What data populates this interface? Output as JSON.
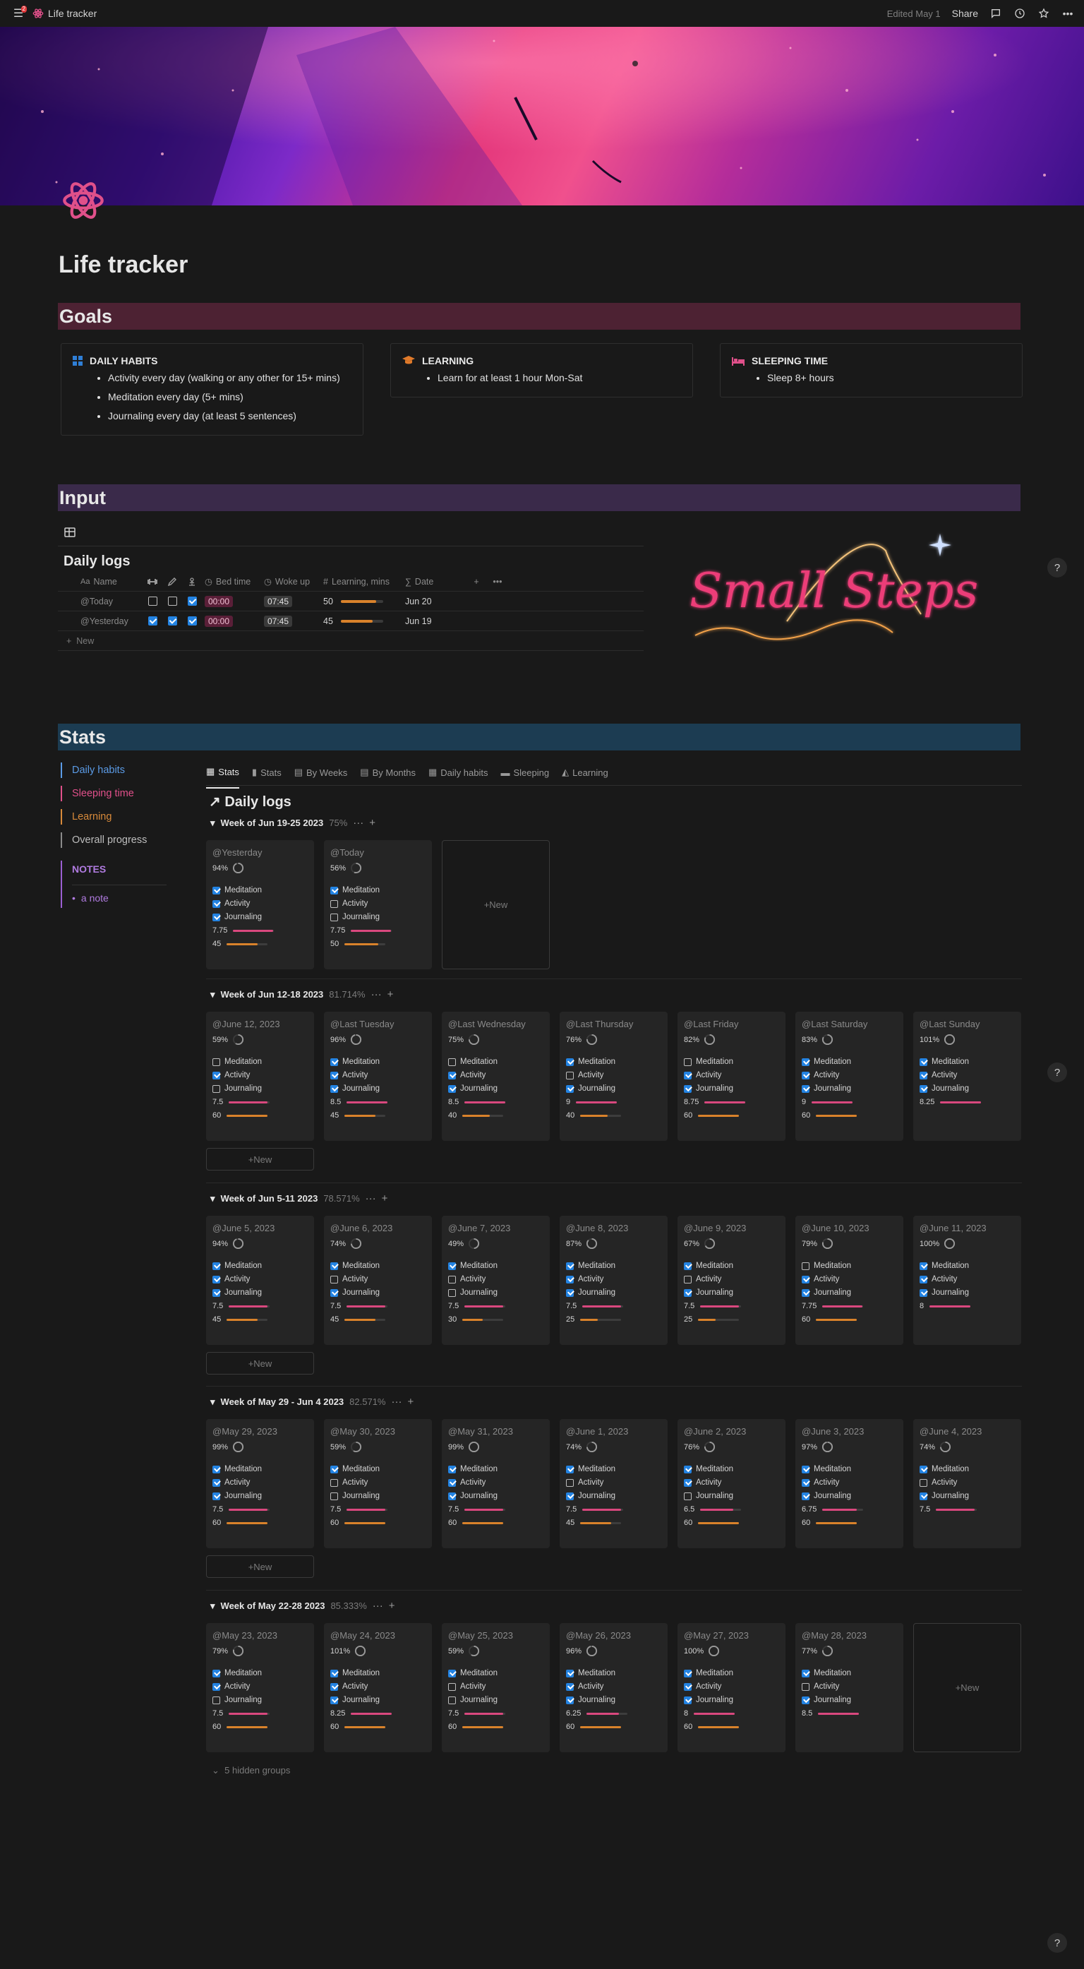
{
  "topbar": {
    "notif_count": "2",
    "page_name": "Life tracker",
    "edited": "Edited May 1",
    "share": "Share"
  },
  "page": {
    "title": "Life tracker"
  },
  "goals": {
    "header": "Goals",
    "cards": [
      {
        "title": "DAILY HABITS",
        "items": [
          "Activity every day (walking or any other for 15+ mins)",
          "Meditation every day (5+ mins)",
          "Journaling every day (at least 5 sentences)"
        ]
      },
      {
        "title": "LEARNING",
        "items": [
          "Learn for at least 1 hour Mon-Sat"
        ]
      },
      {
        "title": "SLEEPING TIME",
        "items": [
          "Sleep 8+ hours"
        ]
      }
    ]
  },
  "input": {
    "header": "Input",
    "db_title": "Daily logs",
    "columns": {
      "name": "Name",
      "bed": "Bed time",
      "woke": "Woke up",
      "learn": "Learning, mins",
      "date": "Date"
    },
    "rows": [
      {
        "name": "@Today",
        "c1": false,
        "c2": false,
        "c3": true,
        "bed": "00:00",
        "woke": "07:45",
        "learn": "50",
        "learn_frac": 0.83,
        "date": "Jun 20"
      },
      {
        "name": "@Yesterday",
        "c1": true,
        "c2": true,
        "c3": true,
        "bed": "00:00",
        "woke": "07:45",
        "learn": "45",
        "learn_frac": 0.75,
        "date": "Jun 19"
      }
    ],
    "new_label": "New"
  },
  "logo": {
    "text": "Small Steps"
  },
  "stats": {
    "header": "Stats",
    "sidebar": [
      {
        "label": "Daily habits",
        "color": "#5b9be6"
      },
      {
        "label": "Sleeping time",
        "color": "#e0508a"
      },
      {
        "label": "Learning",
        "color": "#d88a3a"
      },
      {
        "label": "Overall progress",
        "color": "#bdbdbd"
      }
    ],
    "notes_title": "NOTES",
    "note": "a note",
    "tabs": [
      "Stats",
      "Stats",
      "By Weeks",
      "By Months",
      "Daily habits",
      "Sleeping",
      "Learning"
    ],
    "board_title": "Daily logs",
    "new_label": "New",
    "hidden_groups": "5 hidden groups"
  },
  "labels": {
    "meditation": "Meditation",
    "activity": "Activity",
    "journaling": "Journaling"
  },
  "colors": {
    "pink": "#d9487e",
    "orange": "#d9822b",
    "blue": "#2383e2"
  },
  "groups": [
    {
      "title": "Week of Jun 19-25 2023",
      "pct": "75%",
      "cards": [
        {
          "date": "@Yesterday",
          "pct": "94%",
          "m": true,
          "a": true,
          "j": true,
          "sleep": "7.75",
          "sleep_frac": 0.97,
          "learn": "45",
          "learn_frac": 0.75
        },
        {
          "date": "@Today",
          "pct": "56%",
          "m": true,
          "a": false,
          "j": false,
          "sleep": "7.75",
          "sleep_frac": 0.97,
          "learn": "50",
          "learn_frac": 0.83
        }
      ]
    },
    {
      "title": "Week of Jun 12-18 2023",
      "pct": "81.714%",
      "cards": [
        {
          "date": "@June 12, 2023",
          "pct": "59%",
          "m": false,
          "a": true,
          "j": false,
          "sleep": "7.5",
          "sleep_frac": 0.94,
          "learn": "60",
          "learn_frac": 1.0
        },
        {
          "date": "@Last Tuesday",
          "pct": "96%",
          "m": true,
          "a": true,
          "j": true,
          "sleep": "8.5",
          "sleep_frac": 1.0,
          "learn": "45",
          "learn_frac": 0.75
        },
        {
          "date": "@Last Wednesday",
          "pct": "75%",
          "m": false,
          "a": true,
          "j": true,
          "sleep": "8.5",
          "sleep_frac": 1.0,
          "learn": "40",
          "learn_frac": 0.67
        },
        {
          "date": "@Last Thursday",
          "pct": "76%",
          "m": true,
          "a": false,
          "j": true,
          "sleep": "9",
          "sleep_frac": 1.0,
          "learn": "40",
          "learn_frac": 0.67
        },
        {
          "date": "@Last Friday",
          "pct": "82%",
          "m": false,
          "a": true,
          "j": true,
          "sleep": "8.75",
          "sleep_frac": 1.0,
          "learn": "60",
          "learn_frac": 1.0
        },
        {
          "date": "@Last Saturday",
          "pct": "83%",
          "m": true,
          "a": true,
          "j": true,
          "sleep": "9",
          "sleep_frac": 1.0,
          "learn": "60",
          "learn_frac": 1.0
        },
        {
          "date": "@Last Sunday",
          "pct": "101%",
          "m": true,
          "a": true,
          "j": true,
          "sleep": "8.25",
          "sleep_frac": 1.0,
          "learn": "",
          "learn_frac": 0
        }
      ]
    },
    {
      "title": "Week of Jun 5-11 2023",
      "pct": "78.571%",
      "cards": [
        {
          "date": "@June 5, 2023",
          "pct": "94%",
          "m": true,
          "a": true,
          "j": true,
          "sleep": "7.5",
          "sleep_frac": 0.94,
          "learn": "45",
          "learn_frac": 0.75
        },
        {
          "date": "@June 6, 2023",
          "pct": "74%",
          "m": true,
          "a": false,
          "j": true,
          "sleep": "7.5",
          "sleep_frac": 0.94,
          "learn": "45",
          "learn_frac": 0.75
        },
        {
          "date": "@June 7, 2023",
          "pct": "49%",
          "m": true,
          "a": false,
          "j": false,
          "sleep": "7.5",
          "sleep_frac": 0.94,
          "learn": "30",
          "learn_frac": 0.5
        },
        {
          "date": "@June 8, 2023",
          "pct": "87%",
          "m": true,
          "a": true,
          "j": true,
          "sleep": "7.5",
          "sleep_frac": 0.94,
          "learn": "25",
          "learn_frac": 0.42
        },
        {
          "date": "@June 9, 2023",
          "pct": "67%",
          "m": true,
          "a": false,
          "j": true,
          "sleep": "7.5",
          "sleep_frac": 0.94,
          "learn": "25",
          "learn_frac": 0.42
        },
        {
          "date": "@June 10, 2023",
          "pct": "79%",
          "m": false,
          "a": true,
          "j": true,
          "sleep": "7.75",
          "sleep_frac": 0.97,
          "learn": "60",
          "learn_frac": 1.0
        },
        {
          "date": "@June 11, 2023",
          "pct": "100%",
          "m": true,
          "a": true,
          "j": true,
          "sleep": "8",
          "sleep_frac": 1.0,
          "learn": "",
          "learn_frac": 0
        }
      ]
    },
    {
      "title": "Week of May 29 - Jun 4 2023",
      "pct": "82.571%",
      "cards": [
        {
          "date": "@May 29, 2023",
          "pct": "99%",
          "m": true,
          "a": true,
          "j": true,
          "sleep": "7.5",
          "sleep_frac": 0.94,
          "learn": "60",
          "learn_frac": 1.0
        },
        {
          "date": "@May 30, 2023",
          "pct": "59%",
          "m": true,
          "a": false,
          "j": false,
          "sleep": "7.5",
          "sleep_frac": 0.94,
          "learn": "60",
          "learn_frac": 1.0
        },
        {
          "date": "@May 31, 2023",
          "pct": "99%",
          "m": true,
          "a": true,
          "j": true,
          "sleep": "7.5",
          "sleep_frac": 0.94,
          "learn": "60",
          "learn_frac": 1.0
        },
        {
          "date": "@June 1, 2023",
          "pct": "74%",
          "m": true,
          "a": false,
          "j": true,
          "sleep": "7.5",
          "sleep_frac": 0.94,
          "learn": "45",
          "learn_frac": 0.75
        },
        {
          "date": "@June 2, 2023",
          "pct": "76%",
          "m": true,
          "a": true,
          "j": false,
          "sleep": "6.5",
          "sleep_frac": 0.81,
          "learn": "60",
          "learn_frac": 1.0
        },
        {
          "date": "@June 3, 2023",
          "pct": "97%",
          "m": true,
          "a": true,
          "j": true,
          "sleep": "6.75",
          "sleep_frac": 0.84,
          "learn": "60",
          "learn_frac": 1.0
        },
        {
          "date": "@June 4, 2023",
          "pct": "74%",
          "m": true,
          "a": false,
          "j": true,
          "sleep": "7.5",
          "sleep_frac": 0.94,
          "learn": "",
          "learn_frac": 0
        }
      ]
    },
    {
      "title": "Week of May 22-28 2023",
      "pct": "85.333%",
      "cards": [
        {
          "date": "@May 23, 2023",
          "pct": "79%",
          "m": true,
          "a": true,
          "j": false,
          "sleep": "7.5",
          "sleep_frac": 0.94,
          "learn": "60",
          "learn_frac": 1.0
        },
        {
          "date": "@May 24, 2023",
          "pct": "101%",
          "m": true,
          "a": true,
          "j": true,
          "sleep": "8.25",
          "sleep_frac": 1.0,
          "learn": "60",
          "learn_frac": 1.0
        },
        {
          "date": "@May 25, 2023",
          "pct": "59%",
          "m": true,
          "a": false,
          "j": false,
          "sleep": "7.5",
          "sleep_frac": 0.94,
          "learn": "60",
          "learn_frac": 1.0
        },
        {
          "date": "@May 26, 2023",
          "pct": "96%",
          "m": true,
          "a": true,
          "j": true,
          "sleep": "6.25",
          "sleep_frac": 0.78,
          "learn": "60",
          "learn_frac": 1.0
        },
        {
          "date": "@May 27, 2023",
          "pct": "100%",
          "m": true,
          "a": true,
          "j": true,
          "sleep": "8",
          "sleep_frac": 1.0,
          "learn": "60",
          "learn_frac": 1.0
        },
        {
          "date": "@May 28, 2023",
          "pct": "77%",
          "m": true,
          "a": false,
          "j": true,
          "sleep": "8.5",
          "sleep_frac": 1.0,
          "learn": "",
          "learn_frac": 0
        }
      ]
    }
  ]
}
